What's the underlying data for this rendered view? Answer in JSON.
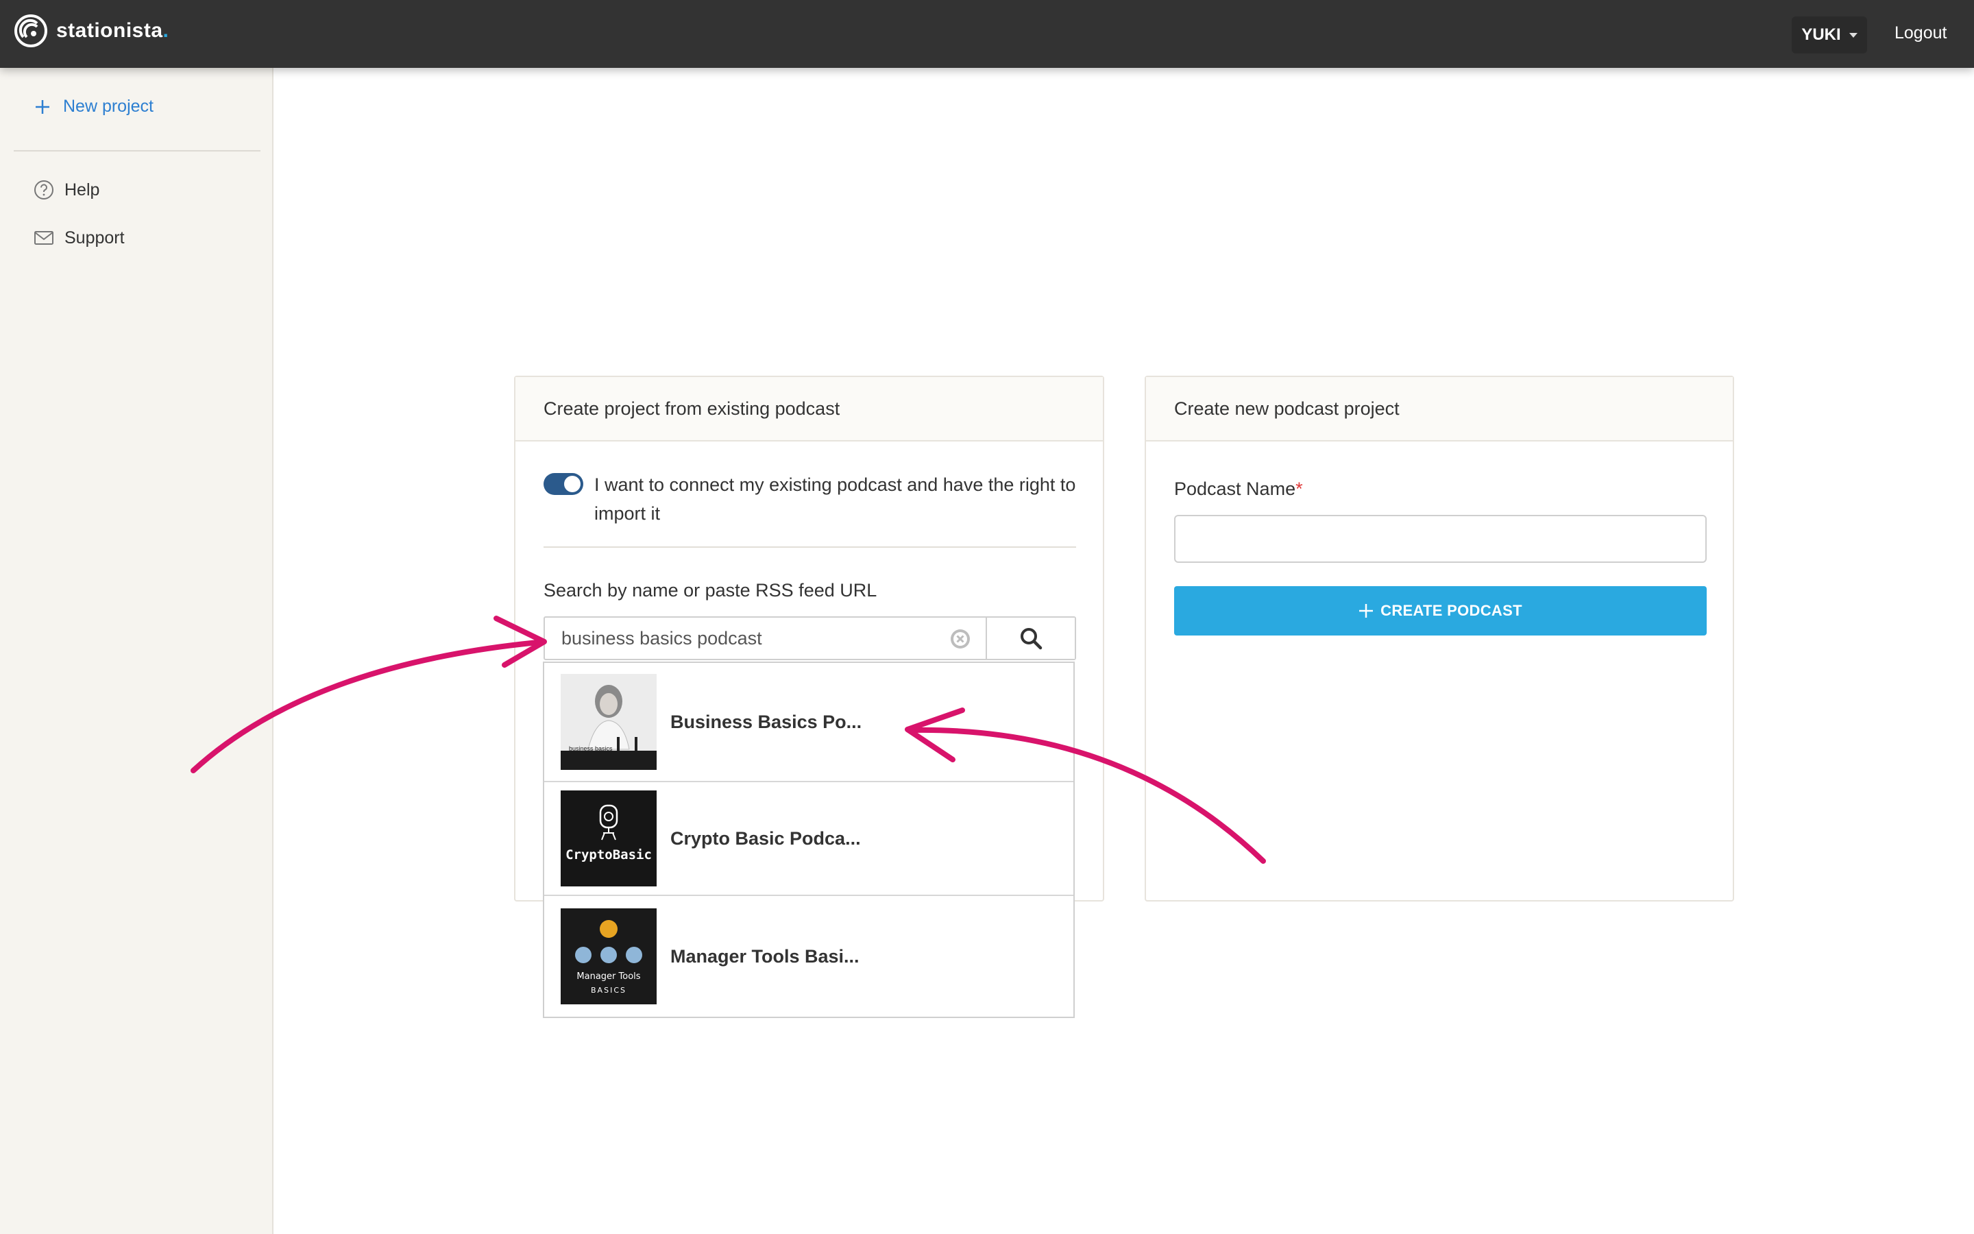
{
  "header": {
    "logo_text": "stationista",
    "logo_dot": ".",
    "user_label": "YUKI",
    "logout_label": "Logout"
  },
  "sidebar": {
    "new_project_label": "New project",
    "links": [
      {
        "label": "Help",
        "icon": "help-circle-icon"
      },
      {
        "label": "Support",
        "icon": "mail-icon"
      }
    ]
  },
  "existing_card": {
    "title": "Create project from existing podcast",
    "toggle_label": "I want to connect my existing podcast and have the right to import it",
    "toggle_on": true,
    "search_label": "Search by name or paste RSS feed URL",
    "search_value": "business basics podcast"
  },
  "new_card": {
    "title": "Create new podcast project",
    "name_label": "Podcast Name",
    "required_mark": "*",
    "name_value": "",
    "create_label": "CREATE PODCAST"
  },
  "results": [
    {
      "title": "Business Basics Po...",
      "thumb_text": "business basics"
    },
    {
      "title": "Crypto Basic Podca...",
      "thumb_text": "CryptoBasic"
    },
    {
      "title": "Manager Tools Basi...",
      "thumb_text_1": "Manager Tools",
      "thumb_text_2": "BASICS"
    }
  ],
  "colors": {
    "topbar": "#333333",
    "accent_blue": "#2aa9e0",
    "link_blue": "#2d7fd1",
    "toggle": "#2b5a8c",
    "annotation_arrow": "#d8136b"
  }
}
